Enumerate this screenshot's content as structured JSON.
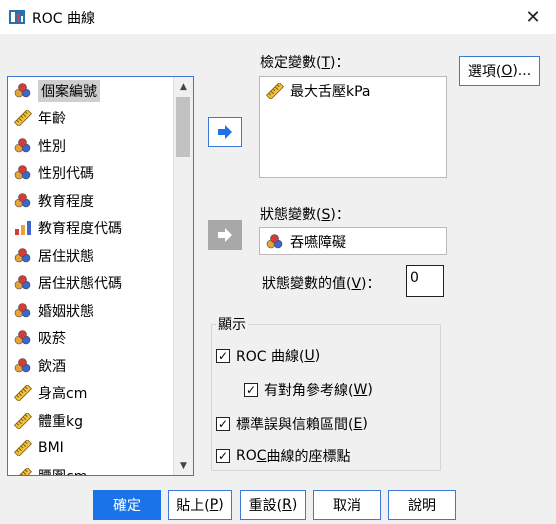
{
  "window": {
    "title": "ROC 曲線",
    "close_label": "✕"
  },
  "variable_list": {
    "items": [
      {
        "label": "個案編號",
        "icon": "nominal-icon",
        "selected": true
      },
      {
        "label": "年齡",
        "icon": "scale-icon"
      },
      {
        "label": "性別",
        "icon": "nominal-icon"
      },
      {
        "label": "性別代碼",
        "icon": "nominal-icon"
      },
      {
        "label": "教育程度",
        "icon": "nominal-icon"
      },
      {
        "label": "教育程度代碼",
        "icon": "ordinal-icon"
      },
      {
        "label": "居住狀態",
        "icon": "nominal-icon"
      },
      {
        "label": "居住狀態代碼",
        "icon": "nominal-icon"
      },
      {
        "label": "婚姻狀態",
        "icon": "nominal-icon"
      },
      {
        "label": "吸菸",
        "icon": "nominal-icon"
      },
      {
        "label": "飲酒",
        "icon": "nominal-icon"
      },
      {
        "label": "身高cm",
        "icon": "scale-icon"
      },
      {
        "label": "體重kg",
        "icon": "scale-icon"
      },
      {
        "label": "BMI",
        "icon": "scale-icon"
      },
      {
        "label": "腰圍cm",
        "icon": "scale-icon"
      }
    ]
  },
  "test_variable": {
    "label_prefix": "檢定變數(",
    "label_key": "T",
    "label_suffix": ")：",
    "value": "最大舌壓kPa"
  },
  "state_variable": {
    "label_prefix": "狀態變數(",
    "label_key": "S",
    "label_suffix": ")：",
    "value": "吞嚥障礙"
  },
  "state_value": {
    "label_prefix": "狀態變數的值(",
    "label_key": "V",
    "label_suffix": ")：",
    "value": "0"
  },
  "options_button": {
    "prefix": "選項(",
    "key": "O",
    "suffix": ")..."
  },
  "display": {
    "title": "顯示",
    "roc_curve": {
      "prefix": "ROC 曲線(",
      "key": "U",
      "suffix": ")",
      "checked": true
    },
    "diagonal": {
      "prefix": "有對角參考線(",
      "key": "W",
      "suffix": ")",
      "checked": true
    },
    "stderr": {
      "prefix": "標準誤與信賴區間(",
      "key": "E",
      "suffix": ")",
      "checked": true
    },
    "coords": {
      "prefix": "RO",
      "key": "C",
      "suffix": " 曲線的座標點",
      "checked": true
    }
  },
  "buttons": {
    "ok": "確定",
    "paste": {
      "prefix": "貼上(",
      "key": "P",
      "suffix": ")"
    },
    "reset": {
      "prefix": "重設(",
      "key": "R",
      "suffix": ")"
    },
    "cancel": "取消",
    "help": "說明"
  },
  "checkmark": "✓"
}
